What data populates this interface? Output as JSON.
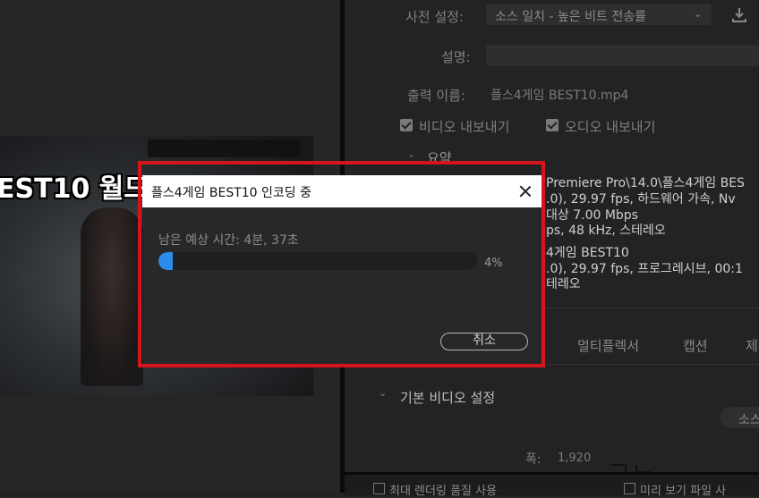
{
  "preview": {
    "title": "EST10 월드"
  },
  "export": {
    "preset_label": "사전 설정:",
    "preset_value": "소스 일치 - 높은 비트 전송률",
    "comment_label": "설명:",
    "output_label": "출력 이름:",
    "output_value": "플스4게임 BEST10.mp4",
    "export_video": "비디오 내보내기",
    "export_audio": "오디오 내보내기",
    "summary_label": "요약",
    "summary_lines": [
      "Premiere  Pro\\14.0\\플스4게임 BES",
      ".0), 29.97 fps, 하드웨어 가속, Nv",
      "대상 7.00 Mbps",
      "ps, 48 kHz, 스테레오",
      "4게임 BEST10",
      ".0),  29.97  fps, 프로그레시브, 00:1",
      "테레오"
    ],
    "tabs": [
      "멀티플렉서",
      "캡션",
      "제"
    ],
    "basic_video_label": "기본 비디오 설정",
    "match_source_btn": "소스",
    "width_label": "폭:",
    "width_value": "1,920",
    "bottom_options": [
      "최대 렌더링 품질 사용",
      "미리 보기 파일 사"
    ]
  },
  "dialog": {
    "title": "플스4게임 BEST10 인코딩 중",
    "remaining": "남은 예상 시간: 4분, 37초",
    "progress": 0.04,
    "progress_text": "4%",
    "cancel": "취소"
  },
  "colors": {
    "accent": "#2d8ceb",
    "highlight": "#d4151e"
  }
}
